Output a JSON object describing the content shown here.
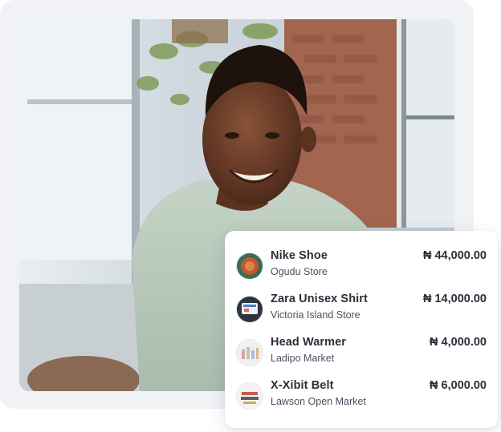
{
  "products": [
    {
      "name": "Nike Shoe",
      "store": "Ogudu Store",
      "price": "₦ 44,000.00",
      "icon": "shoe-thumbnail-icon"
    },
    {
      "name": "Zara Unisex Shirt",
      "store": "Victoria Island Store",
      "price": "₦ 14,000.00",
      "icon": "shirt-thumbnail-icon"
    },
    {
      "name": "Head Warmer",
      "store": "Ladipo Market",
      "price": "₦ 4,000.00",
      "icon": "warmer-thumbnail-icon"
    },
    {
      "name": "X-Xibit Belt",
      "store": "Lawson Open Market",
      "price": "₦ 6,000.00",
      "icon": "belt-thumbnail-icon"
    }
  ]
}
